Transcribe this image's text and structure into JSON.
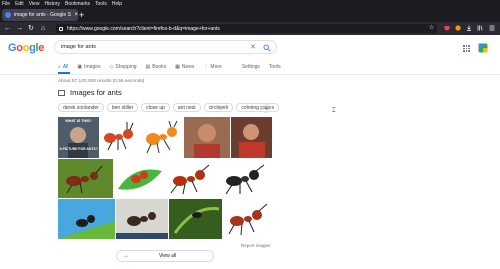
{
  "menu": [
    "File",
    "Edit",
    "View",
    "History",
    "Bookmarks",
    "Tools",
    "Help"
  ],
  "tab": {
    "title": "image for ants - Google Search",
    "close": "×",
    "new_tab": "+"
  },
  "nav": {
    "url": "https://www.google.com/search?client=firefox-b-d&q=image+for+ants",
    "back": "←",
    "forward": "→",
    "reload": "↻",
    "home": "⌂"
  },
  "search": {
    "value": "image for ants",
    "clear": "✕"
  },
  "logo": {
    "letters": [
      "G",
      "o",
      "o",
      "g",
      "l",
      "e"
    ],
    "colors": [
      "#4285f4",
      "#ea4335",
      "#fbbc05",
      "#4285f4",
      "#34a853",
      "#ea4335"
    ]
  },
  "result_tabs": [
    {
      "icon": "⌕",
      "label": "All",
      "active": true
    },
    {
      "icon": "▣",
      "label": "Images"
    },
    {
      "icon": "◇",
      "label": "Shopping"
    },
    {
      "icon": "▤",
      "label": "Books"
    },
    {
      "icon": "▦",
      "label": "News"
    },
    {
      "icon": "⋮",
      "label": "More"
    },
    {
      "icon": "",
      "label": "Settings"
    },
    {
      "icon": "",
      "label": "Tools"
    }
  ],
  "stats": "About 57,100,000 results (0.55 seconds)",
  "images_header": "Images for ants",
  "chips": [
    "derek zoolander",
    "ben stiller",
    "close up",
    "ant nest",
    "circlejerk",
    "coloring pages"
  ],
  "chips_more": "⌄",
  "meme_text": {
    "top": "WHAT IS THIS?",
    "bottom": "A PICTURE FOR ANTS?"
  },
  "report": "Report images",
  "view_all": {
    "arrow": "→",
    "label": "View all"
  },
  "accent": "#1a73e8"
}
